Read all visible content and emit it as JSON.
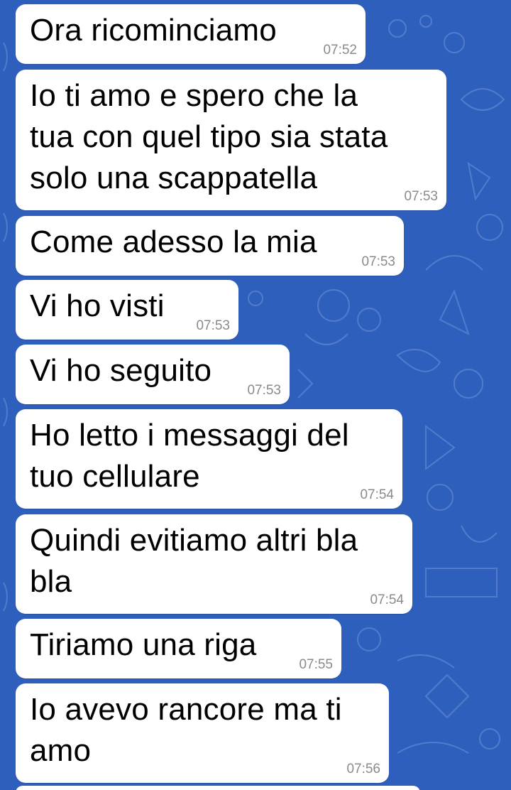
{
  "chat": {
    "background_color": "#2f5fbd",
    "bubble_color": "#ffffff",
    "messages": [
      {
        "text": "Ora ricominciamo",
        "time": "07:52"
      },
      {
        "text": "Io ti amo e spero che la tua con quel tipo sia stata solo una scappatella",
        "time": "07:53"
      },
      {
        "text": "Come adesso la mia",
        "time": "07:53"
      },
      {
        "text": "Vi ho visti",
        "time": "07:53"
      },
      {
        "text": "Vi ho seguito",
        "time": "07:53"
      },
      {
        "text": "Ho letto i messaggi del tuo cellulare",
        "time": "07:54"
      },
      {
        "text": "Quindi evitiamo altri bla bla",
        "time": "07:54"
      },
      {
        "text": "Tiriamo una riga",
        "time": "07:55"
      },
      {
        "text": "Io avevo rancore ma ti amo",
        "time": "07:56"
      }
    ]
  }
}
